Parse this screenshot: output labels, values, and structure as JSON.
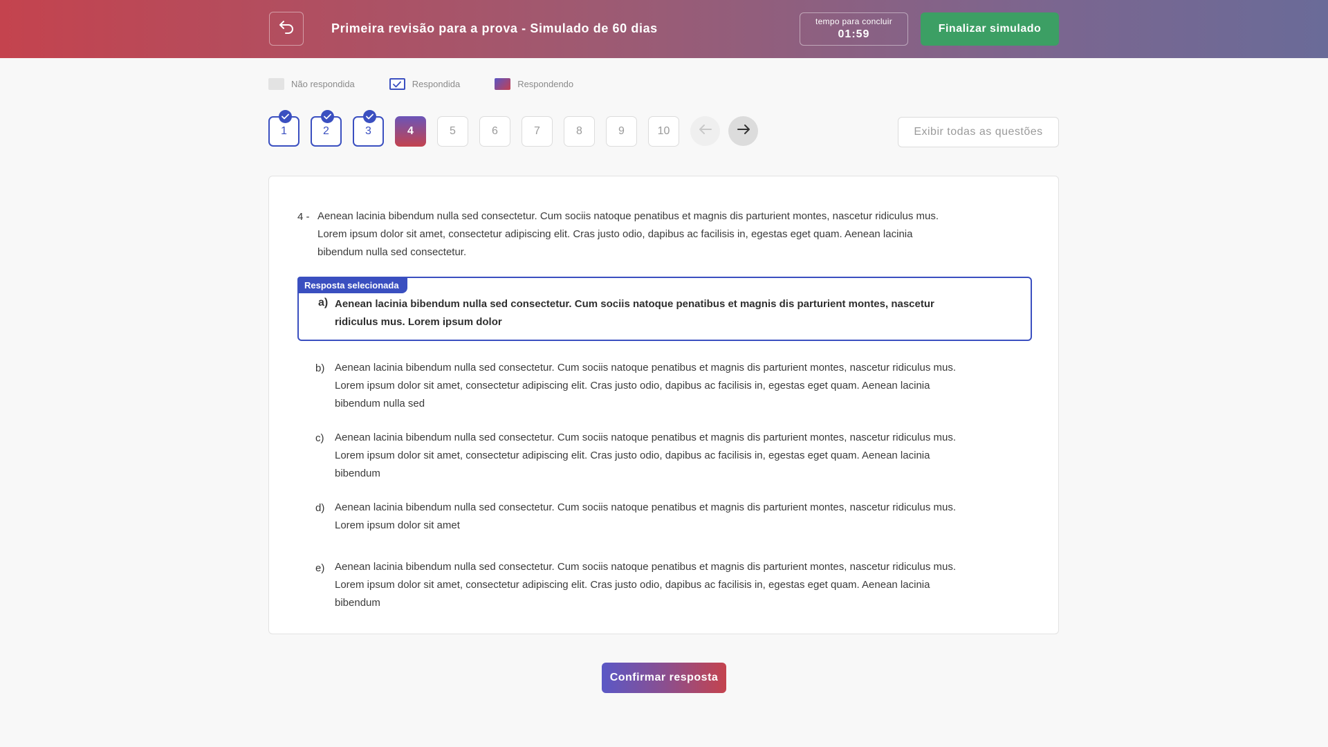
{
  "header": {
    "title": "Primeira revisão para a prova - Simulado de 60 dias",
    "timer_label": "tempo para concluir",
    "timer_value": "01:59",
    "finish_label": "Finalizar simulado",
    "back_icon": "undo-arrow-icon"
  },
  "legend": {
    "not_answered": "Não respondida",
    "answered": "Respondida",
    "answering": "Respondendo"
  },
  "nav": {
    "questions": [
      {
        "label": "1",
        "state": "answered"
      },
      {
        "label": "2",
        "state": "answered"
      },
      {
        "label": "3",
        "state": "answered"
      },
      {
        "label": "4",
        "state": "current"
      },
      {
        "label": "5",
        "state": "unanswered"
      },
      {
        "label": "6",
        "state": "unanswered"
      },
      {
        "label": "7",
        "state": "unanswered"
      },
      {
        "label": "8",
        "state": "unanswered"
      },
      {
        "label": "9",
        "state": "unanswered"
      },
      {
        "label": "10",
        "state": "unanswered"
      }
    ],
    "show_all_label": "Exibir todas as questões",
    "prev_icon": "arrow-left-icon",
    "next_icon": "arrow-right-icon"
  },
  "question": {
    "number": "4 -",
    "text": "Aenean lacinia bibendum nulla sed consectetur. Cum sociis natoque penatibus et magnis dis parturient montes, nascetur ridiculus mus. Lorem ipsum dolor sit amet, consectetur adipiscing elit. Cras justo odio, dapibus ac facilisis in, egestas eget quam. Aenean lacinia bibendum nulla sed consectetur.",
    "selected_tag": "Resposta selecionada",
    "options": [
      {
        "letter": "a)",
        "text": "Aenean lacinia bibendum nulla sed consectetur. Cum sociis natoque penatibus et magnis dis parturient montes, nascetur ridiculus mus. Lorem ipsum dolor"
      },
      {
        "letter": "b)",
        "text": "Aenean lacinia bibendum nulla sed consectetur. Cum sociis natoque penatibus et magnis dis parturient montes, nascetur ridiculus mus. Lorem ipsum dolor sit amet, consectetur adipiscing elit. Cras justo odio, dapibus ac facilisis in, egestas eget quam. Aenean lacinia bibendum nulla sed"
      },
      {
        "letter": "c)",
        "text": "Aenean lacinia bibendum nulla sed consectetur. Cum sociis natoque penatibus et magnis dis parturient montes, nascetur ridiculus mus. Lorem ipsum dolor sit amet, consectetur adipiscing elit. Cras justo odio, dapibus ac facilisis in, egestas eget quam. Aenean lacinia bibendum"
      },
      {
        "letter": "d)",
        "text": "Aenean lacinia bibendum nulla sed consectetur. Cum sociis natoque penatibus et magnis dis parturient montes, nascetur ridiculus mus. Lorem ipsum dolor sit amet"
      },
      {
        "letter": "e)",
        "text": "Aenean lacinia bibendum nulla sed consectetur. Cum sociis natoque penatibus et magnis dis parturient montes, nascetur ridiculus mus. Lorem ipsum dolor sit amet, consectetur adipiscing elit. Cras justo odio, dapibus ac facilisis in, egestas eget quam. Aenean lacinia bibendum"
      }
    ],
    "selected_index": 0
  },
  "confirm_label": "Confirmar resposta",
  "colors": {
    "accent_blue": "#3a4fc0",
    "finish_green": "#3c9f64",
    "brand_red": "#c4434e"
  }
}
